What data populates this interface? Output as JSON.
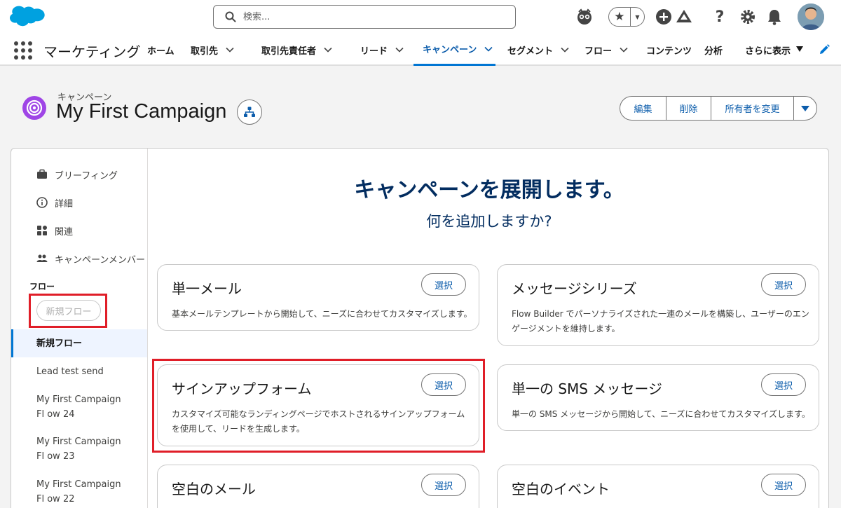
{
  "header": {
    "search_placeholder": "検索..."
  },
  "nav": {
    "app_name": "マーケティング",
    "items": [
      {
        "label": "ホーム"
      },
      {
        "label": "取引先"
      },
      {
        "label": "取引先責任者"
      },
      {
        "label": "リード"
      },
      {
        "label": "キャンペーン"
      },
      {
        "label": "セグメント"
      },
      {
        "label": "フロー"
      },
      {
        "label": "コンテンツ"
      },
      {
        "label": "分析"
      },
      {
        "label": "さらに表示"
      }
    ],
    "active_item": "キャンペーン"
  },
  "record": {
    "object_label": "キャンペーン",
    "title": "My First Campaign",
    "actions": {
      "edit": "編集",
      "delete": "削除",
      "change_owner": "所有者を変更"
    }
  },
  "sidebar": {
    "items": [
      {
        "label": "ブリーフィング",
        "icon": "briefcase-icon"
      },
      {
        "label": "詳細",
        "icon": "info-icon"
      },
      {
        "label": "関連",
        "icon": "related-icon"
      },
      {
        "label": "キャンペーンメンバー",
        "icon": "members-icon"
      }
    ],
    "flow_heading": "フロー",
    "new_flow_button": "新規フロー",
    "flows": [
      {
        "label": "新規フロー",
        "active": true
      },
      {
        "label": "Lead test send"
      },
      {
        "label": "My First Campaign Fl ow 24"
      },
      {
        "label": "My First Campaign Fl ow 23"
      },
      {
        "label": "My First Campaign Fl ow 22"
      }
    ]
  },
  "main": {
    "title": "キャンペーンを展開します。",
    "subtitle": "何を追加しますか?",
    "select_label": "選択",
    "options": [
      {
        "title": "単一メール",
        "desc": "基本メールテンプレートから開始して、ニーズに合わせてカスタマイズします。"
      },
      {
        "title": "メッセージシリーズ",
        "desc": "Flow Builder でパーソナライズされた一連のメールを構築し、ユーザーのエンゲージメントを維持します。"
      },
      {
        "title": "サインアップフォーム",
        "desc": "カスタマイズ可能なランディングページでホストされるサインアップフォームを使用して、リードを生成します。"
      },
      {
        "title": "単一の SMS メッセージ",
        "desc": "単一の SMS メッセージから開始して、ニーズに合わせてカスタマイズします。"
      },
      {
        "title": "空白のメール",
        "desc": ""
      },
      {
        "title": "空白のイベント",
        "desc": ""
      }
    ]
  },
  "colors": {
    "brand_blue": "#0176d3",
    "link_blue": "#0b5cab",
    "title_navy": "#032d60",
    "campaign_purple": "#9f45e6",
    "highlight_red": "#e01e28"
  }
}
